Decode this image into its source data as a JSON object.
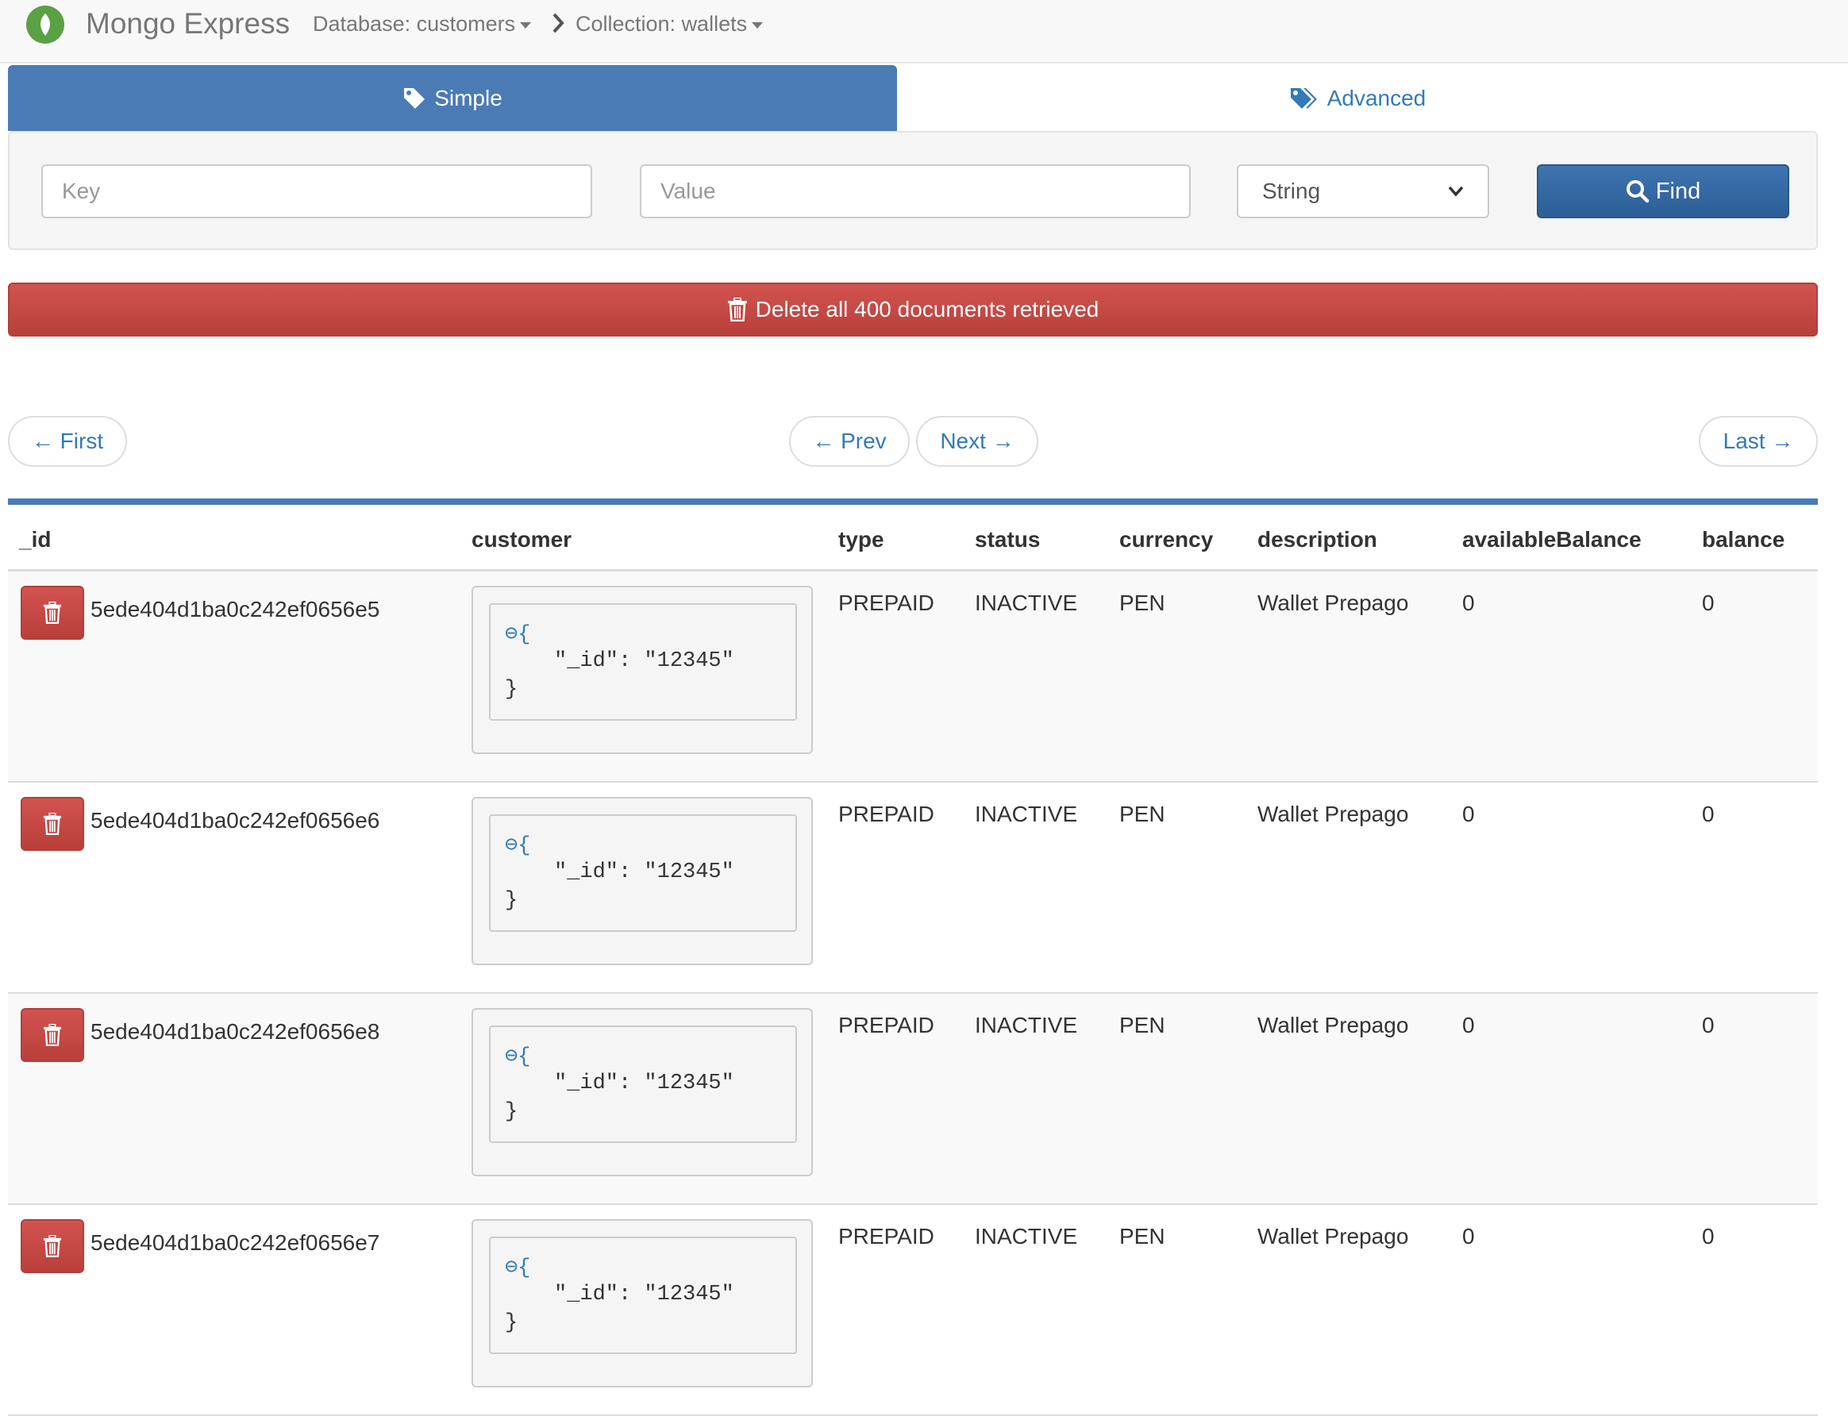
{
  "navbar": {
    "brand": "Mongo Express",
    "database_label": "Database: customers",
    "collection_label": "Collection: wallets",
    "icons": {
      "logo": "leaf-icon",
      "separator": "chevron-right-icon",
      "caret": "caret-down-icon"
    }
  },
  "tabs": {
    "simple": {
      "label": "Simple",
      "icon": "tag-icon",
      "active": true
    },
    "advanced": {
      "label": "Advanced",
      "icon": "tags-icon",
      "active": false
    }
  },
  "search": {
    "key_placeholder": "Key",
    "value_placeholder": "Value",
    "type_selected": "String",
    "find_label": "Find"
  },
  "delete_all_label": "Delete all 400 documents retrieved",
  "pager": {
    "first": "← First",
    "prev": "← Prev",
    "next": "Next →",
    "last": "Last →"
  },
  "table": {
    "headers": {
      "id": "_id",
      "customer": "customer",
      "type": "type",
      "status": "status",
      "currency": "currency",
      "description": "description",
      "availableBalance": "availableBalance",
      "balance": "balance"
    },
    "rows": [
      {
        "id": "5ede404d1ba0c242ef0656e5",
        "customer": {
          "open": "⊖{",
          "line": "\"_id\": \"12345\"",
          "close": "}"
        },
        "type": "PREPAID",
        "status": "INACTIVE",
        "currency": "PEN",
        "description": "Wallet Prepago",
        "availableBalance": "0",
        "balance": "0"
      },
      {
        "id": "5ede404d1ba0c242ef0656e6",
        "customer": {
          "open": "⊖{",
          "line": "\"_id\": \"12345\"",
          "close": "}"
        },
        "type": "PREPAID",
        "status": "INACTIVE",
        "currency": "PEN",
        "description": "Wallet Prepago",
        "availableBalance": "0",
        "balance": "0"
      },
      {
        "id": "5ede404d1ba0c242ef0656e8",
        "customer": {
          "open": "⊖{",
          "line": "\"_id\": \"12345\"",
          "close": "}"
        },
        "type": "PREPAID",
        "status": "INACTIVE",
        "currency": "PEN",
        "description": "Wallet Prepago",
        "availableBalance": "0",
        "balance": "0"
      },
      {
        "id": "5ede404d1ba0c242ef0656e7",
        "customer": {
          "open": "⊖{",
          "line": "\"_id\": \"12345\"",
          "close": "}"
        },
        "type": "PREPAID",
        "status": "INACTIVE",
        "currency": "PEN",
        "description": "Wallet Prepago",
        "availableBalance": "0",
        "balance": "0"
      }
    ]
  },
  "colors": {
    "primary": "#4a7bb4",
    "link": "#337ab7",
    "danger": "#c9302c",
    "logo_green": "#5aa044"
  }
}
